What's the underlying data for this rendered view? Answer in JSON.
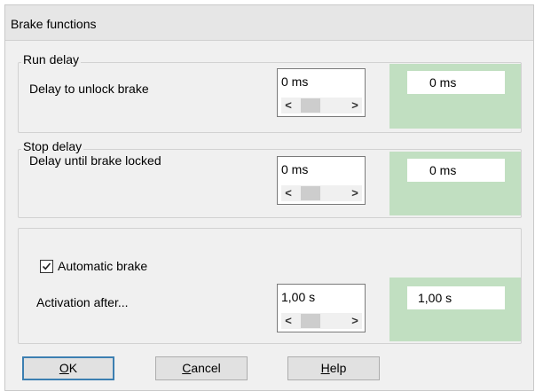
{
  "window": {
    "title": "Brake functions"
  },
  "run_delay": {
    "group_label": "Run delay",
    "label": "Delay to unlock brake",
    "input_value": "0 ms",
    "readout_value": "0 ms",
    "left_arrow": "<",
    "right_arrow": ">"
  },
  "stop_delay": {
    "group_label": "Stop delay",
    "label": "Delay until brake locked",
    "input_value": "0 ms",
    "readout_value": "0 ms",
    "left_arrow": "<",
    "right_arrow": ">"
  },
  "automatic": {
    "checkbox_label": "Automatic brake",
    "checked": true,
    "label": "Activation after...",
    "input_value": "1,00 s",
    "readout_value": "1,00 s",
    "left_arrow": "<",
    "right_arrow": ">"
  },
  "buttons": {
    "ok": {
      "mnemonic": "O",
      "rest": "K"
    },
    "cancel": {
      "mnemonic": "C",
      "rest": "ancel"
    },
    "help": {
      "mnemonic": "H",
      "rest": "elp"
    }
  },
  "colors": {
    "readout_panel": "#c1dfc1",
    "default_button_border": "#3c7fb1"
  }
}
